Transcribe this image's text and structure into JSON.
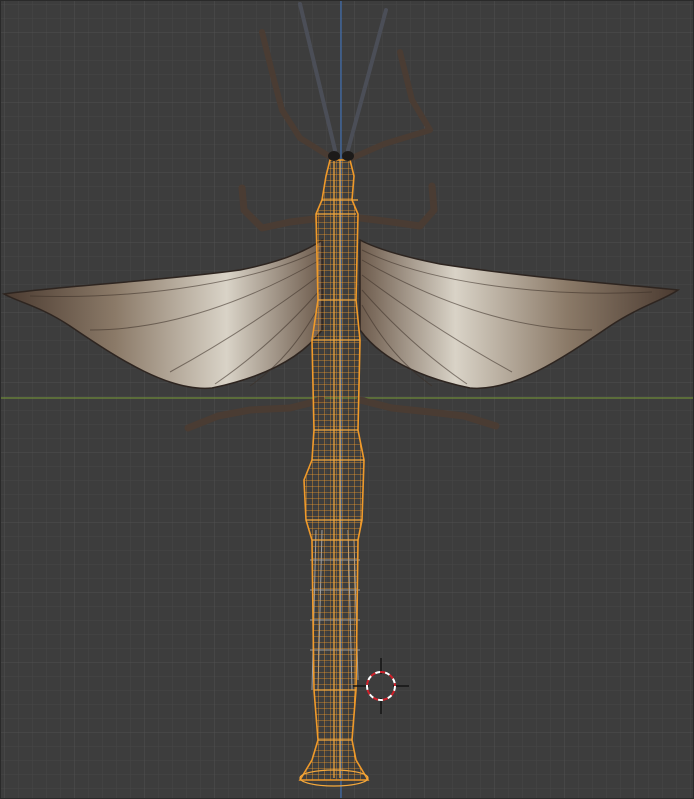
{
  "viewport": {
    "background": "#3d3d3d",
    "grid_minor_color": "#484848",
    "grid_major_color": "#4f4f4f",
    "x_axis_color": "#6e8a3a",
    "z_axis_color": "#3f6fb0"
  },
  "scene": {
    "selected_object": "oboe-body",
    "selection_color": "#e08a1e",
    "wing_colors": [
      "#5a4a3e",
      "#d8d2c6",
      "#8a7b6c"
    ],
    "leg_color": "#4a3c33",
    "cursor_color": "#d0202a"
  },
  "icons": {
    "3d_cursor": "crosshair-icon"
  }
}
